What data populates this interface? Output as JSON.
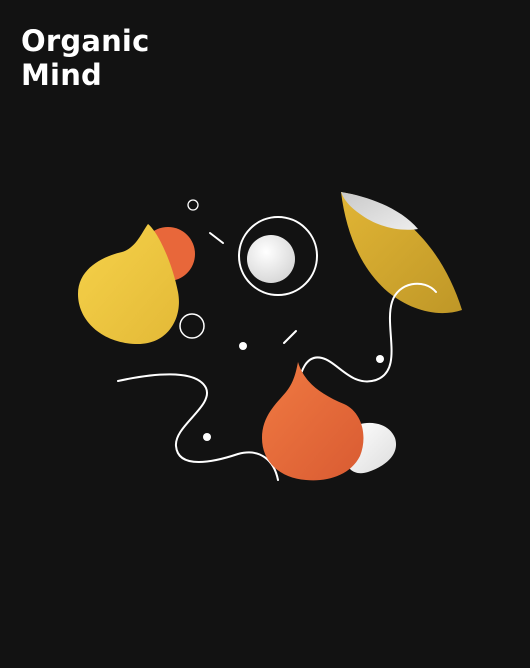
{
  "brand": {
    "title_line1": "Organic",
    "title_line2": "Mind"
  },
  "theme": {
    "background": "#121212",
    "yellow": "#F0C43A",
    "orange": "#E8673A",
    "white": "#FFFFFF"
  },
  "illustration": {
    "shapes": [
      "yellow-blob",
      "orange-circle",
      "outlined-ring-with-white-ball",
      "yellow-leaf-with-grey-tip",
      "orange-flame-drop",
      "white-pebble",
      "small-ring",
      "tiny-ring",
      "white-dots",
      "white-dashes",
      "wavy-lines"
    ]
  }
}
